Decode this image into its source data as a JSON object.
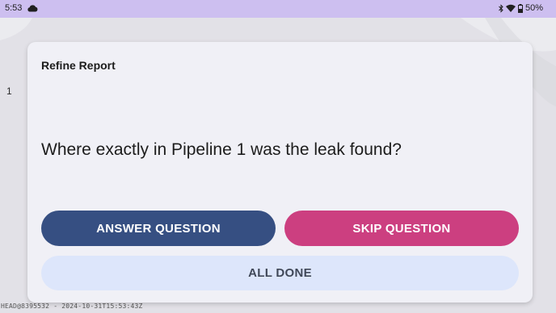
{
  "status_bar": {
    "time": "5:53",
    "battery": "50%",
    "icons": [
      "cloud-icon",
      "bluetooth-icon",
      "wifi-icon",
      "battery-icon"
    ],
    "background_color": "#cdbff0"
  },
  "background": {
    "row_number": "1",
    "footer": "HEAD@8395532 - 2024-10-31T15:53:43Z"
  },
  "dialog": {
    "title": "Refine Report",
    "question": "Where exactly in Pipeline 1 was the leak found?",
    "buttons": {
      "answer": "ANSWER QUESTION",
      "skip": "SKIP QUESTION",
      "done": "ALL DONE"
    },
    "colors": {
      "answer": "#364f82",
      "skip": "#cc3f80",
      "done": "#dde6fb"
    }
  }
}
